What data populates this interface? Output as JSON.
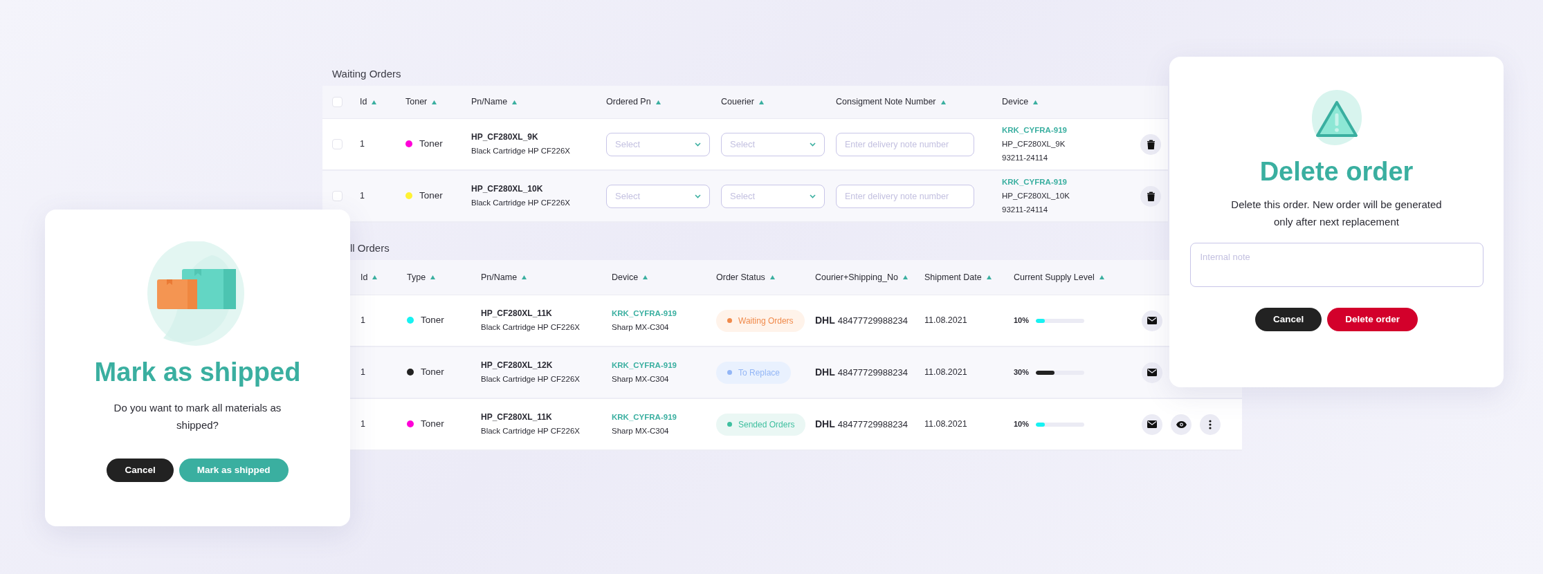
{
  "waiting_orders": {
    "title": "Waiting Orders",
    "header_checked": false,
    "columns": [
      "Id",
      "Toner",
      "Pn/Name",
      "Ordered Pn",
      "Couerier",
      "Consigment Note Number",
      "Device"
    ],
    "rows": [
      {
        "checked": false,
        "id": "1",
        "toner": {
          "color": "#ff00d8",
          "label": "Toner"
        },
        "pn": "HP_CF280XL_9K",
        "name": "Black Cartridge HP CF226X",
        "ordered_pn": {
          "placeholder": "Select"
        },
        "courier": {
          "placeholder": "Select"
        },
        "consignment": {
          "placeholder": "Enter delivery note number"
        },
        "device": {
          "code": "KRK_CYFRA-919",
          "pn": "HP_CF280XL_9K",
          "serial": "93211-24114"
        },
        "actions": [
          {
            "kind": "delete"
          }
        ]
      },
      {
        "checked": false,
        "id": "1",
        "toner": {
          "color": "#fff234",
          "label": "Toner"
        },
        "pn": "HP_CF280XL_10K",
        "name": "Black Cartridge HP CF226X",
        "ordered_pn": {
          "placeholder": "Select"
        },
        "courier": {
          "placeholder": "Select"
        },
        "consignment": {
          "placeholder": "Enter delivery note number"
        },
        "device": {
          "code": "KRK_CYFRA-919",
          "pn": "HP_CF280XL_10K",
          "serial": "93211-24114"
        },
        "actions": [
          {
            "kind": "delete"
          }
        ]
      }
    ]
  },
  "all_orders": {
    "title": "ll Orders",
    "columns": [
      "Id",
      "Type",
      "Pn/Name",
      "Device",
      "Order Status",
      "Courier+Shipping_No",
      "Shipment Date",
      "Current Supply Level"
    ],
    "rows": [
      {
        "id": "1",
        "type": {
          "color": "#17f2f2",
          "label": "Toner"
        },
        "pn": "HP_CF280XL_11K",
        "name": "Black Cartridge HP CF226X",
        "device": {
          "code": "KRK_CYFRA-919",
          "model": "Sharp MX-C304"
        },
        "status": {
          "kind": "waiting",
          "label": "Waiting Orders"
        },
        "courier": "DHL",
        "shipping_no": "48477729988234",
        "date": "11.08.2021",
        "supply": {
          "reading": "10%",
          "level": 0.18,
          "color": "#17f2f2"
        },
        "actions": [
          {
            "kind": "mail"
          }
        ]
      },
      {
        "id": "1",
        "type": {
          "color": "#222222",
          "label": "Toner"
        },
        "pn": "HP_CF280XL_12K",
        "name": "Black Cartridge HP CF226X",
        "device": {
          "code": "KRK_CYFRA-919",
          "model": "Sharp MX-C304"
        },
        "status": {
          "kind": "replace",
          "label": "To Replace"
        },
        "courier": "DHL",
        "shipping_no": "48477729988234",
        "date": "11.08.2021",
        "supply": {
          "reading": "30%",
          "level": 0.38,
          "color": "#222222"
        },
        "actions": [
          {
            "kind": "mail"
          }
        ]
      },
      {
        "id": "1",
        "type": {
          "color": "#ff00d8",
          "label": "Toner"
        },
        "pn": "HP_CF280XL_11K",
        "name": "Black Cartridge HP CF226X",
        "device": {
          "code": "KRK_CYFRA-919",
          "model": "Sharp MX-C304"
        },
        "status": {
          "kind": "sended",
          "label": "Sended Orders"
        },
        "courier": "DHL",
        "shipping_no": "48477729988234",
        "date": "11.08.2021",
        "supply": {
          "reading": "10%",
          "level": 0.18,
          "color": "#17f2f2"
        },
        "actions": [
          {
            "kind": "mail"
          },
          {
            "kind": "view"
          },
          {
            "kind": "more"
          }
        ]
      }
    ]
  },
  "ship_dialog": {
    "title": "Mark as shipped",
    "message": "Do you want to mark all materials as shipped?",
    "buttons": [
      {
        "label": "Cancel",
        "kind": "secondary"
      },
      {
        "label": "Mark as shipped",
        "kind": "primary"
      }
    ]
  },
  "delete_dialog": {
    "title": "Delete order",
    "message": "Delete this order. New order will be generated only after next replacement",
    "note": {
      "placeholder": "Internal note"
    },
    "buttons": [
      {
        "label": "Cancel",
        "kind": "secondary"
      },
      {
        "label": "Delete order",
        "kind": "danger"
      }
    ]
  }
}
